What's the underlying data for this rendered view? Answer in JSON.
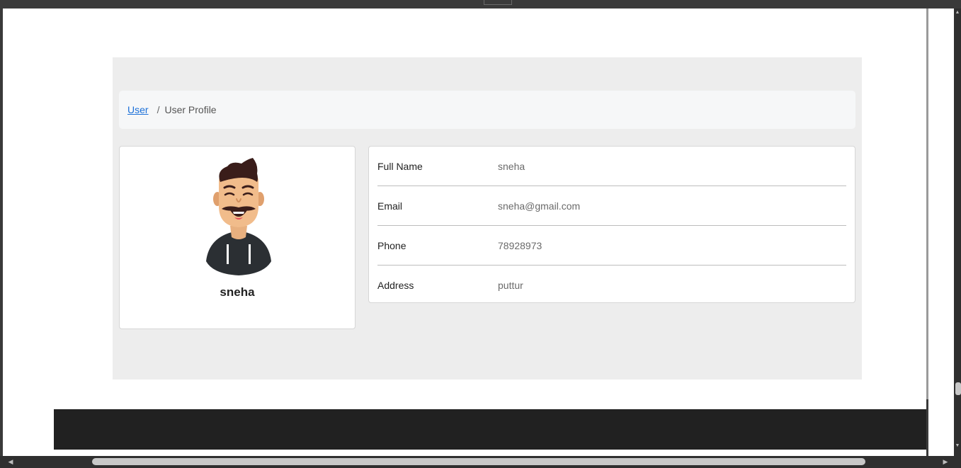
{
  "breadcrumb": {
    "link_label": "User",
    "separator": "/",
    "current_label": "User Profile"
  },
  "profile": {
    "name": "sneha",
    "avatar_icon": "avatar-illustration"
  },
  "details": {
    "rows": [
      {
        "label": "Full Name",
        "value": "sneha"
      },
      {
        "label": "Email",
        "value": "sneha@gmail.com"
      },
      {
        "label": "Phone",
        "value": "78928973"
      },
      {
        "label": "Address",
        "value": "puttur"
      }
    ]
  },
  "colors": {
    "link": "#1a6fd8",
    "panel_bg": "#ededed",
    "footer_bg": "#212121"
  }
}
